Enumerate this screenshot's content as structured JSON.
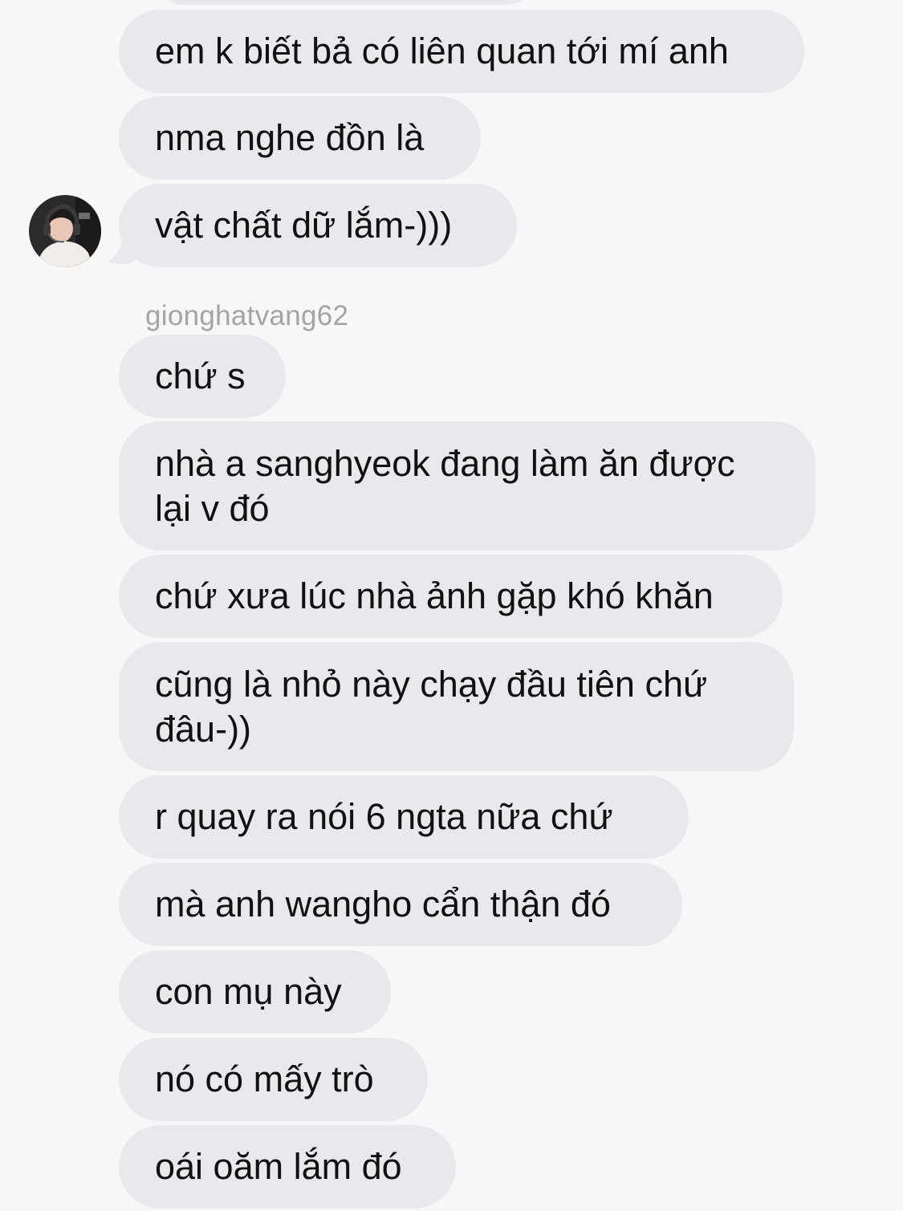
{
  "sender_name": "gionghatvang62",
  "avatar_icon": "user-avatar-headset",
  "colors": {
    "background": "#f7f7f8",
    "bubble": "#e9e8ed",
    "text": "#111111",
    "username": "#a3a3a8"
  },
  "first_group": [
    "em k biết bả có liên quan tới mí anh",
    "nma nghe đồn là",
    "vật chất dữ lắm-)))"
  ],
  "second_group": [
    "chứ s",
    "nhà a sanghyeok đang làm ăn được lại v đó",
    "chứ xưa lúc nhà ảnh gặp khó khăn",
    "cũng là nhỏ này chạy đầu tiên chứ đâu-))",
    "r quay ra nói 6 ngta nữa chứ",
    "mà anh wangho cẩn thận đó",
    "con mụ này",
    "nó có mấy trò",
    "oái oăm lắm đó"
  ]
}
